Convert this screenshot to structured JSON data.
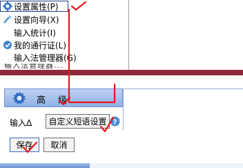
{
  "menu": {
    "items": [
      {
        "label": "设置属性(P)",
        "icon": "gear-icon"
      },
      {
        "label": "设置向导(X)",
        "icon": "wand-icon"
      },
      {
        "label": "输入统计(I)",
        "icon": ""
      },
      {
        "label": "我的通行证(L)",
        "icon": "check-circle-icon"
      },
      {
        "label": "输入法管理器(G)",
        "icon": ""
      }
    ],
    "truncated_item": "输入法管理器..."
  },
  "dialog": {
    "advanced_label": "高级",
    "input_label": "输入Δ",
    "custom_phrase_button": "自定义短语设置",
    "save_button": "保存",
    "cancel_button": "取消"
  },
  "colors": {
    "annotation": "#e8141c",
    "highlight_border": "#1f3f8f",
    "separator": "#8b2a3a",
    "advanced_bar": "#9fbcea"
  }
}
